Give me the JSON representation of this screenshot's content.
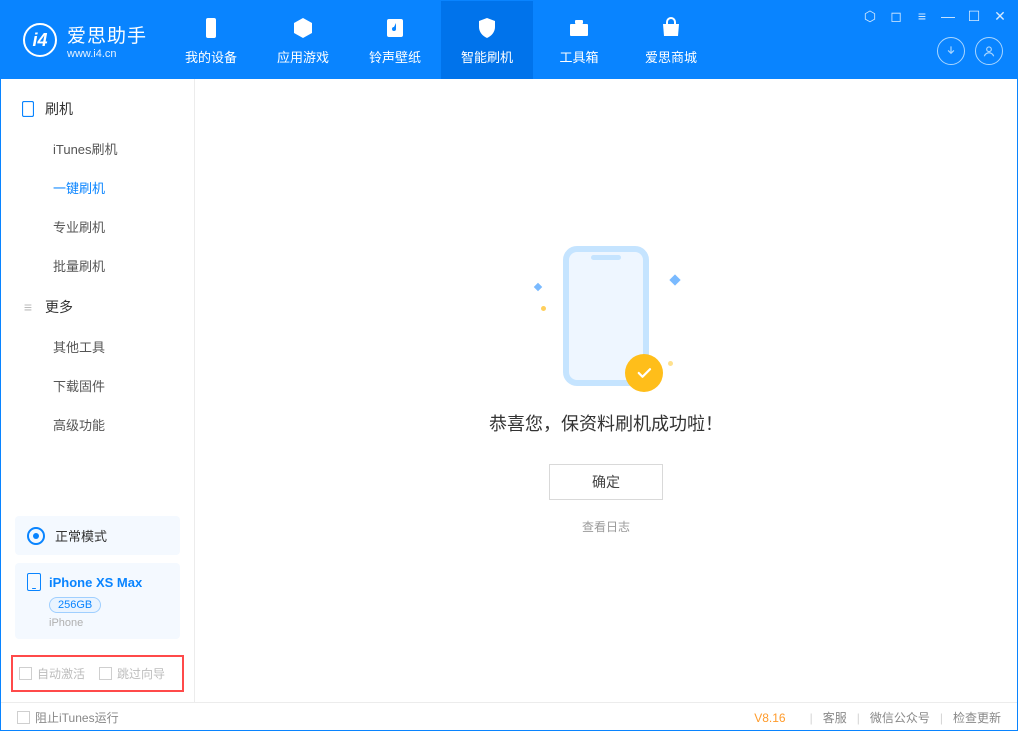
{
  "app": {
    "title": "爱思助手",
    "subtitle": "www.i4.cn"
  },
  "nav": {
    "tabs": [
      {
        "label": "我的设备"
      },
      {
        "label": "应用游戏"
      },
      {
        "label": "铃声壁纸"
      },
      {
        "label": "智能刷机"
      },
      {
        "label": "工具箱"
      },
      {
        "label": "爱思商城"
      }
    ]
  },
  "sidebar": {
    "flash": {
      "header": "刷机",
      "items": [
        {
          "label": "iTunes刷机"
        },
        {
          "label": "一键刷机"
        },
        {
          "label": "专业刷机"
        },
        {
          "label": "批量刷机"
        }
      ]
    },
    "more": {
      "header": "更多",
      "items": [
        {
          "label": "其他工具"
        },
        {
          "label": "下载固件"
        },
        {
          "label": "高级功能"
        }
      ]
    },
    "mode_label": "正常模式",
    "device": {
      "name": "iPhone XS Max",
      "storage": "256GB",
      "type": "iPhone"
    },
    "options": {
      "auto_activate": "自动激活",
      "skip_guide": "跳过向导"
    }
  },
  "main": {
    "success_text": "恭喜您，保资料刷机成功啦！",
    "ok_label": "确定",
    "log_link": "查看日志"
  },
  "statusbar": {
    "block_itunes": "阻止iTunes运行",
    "version": "V8.16",
    "links": {
      "support": "客服",
      "wechat": "微信公众号",
      "update": "检查更新"
    }
  }
}
